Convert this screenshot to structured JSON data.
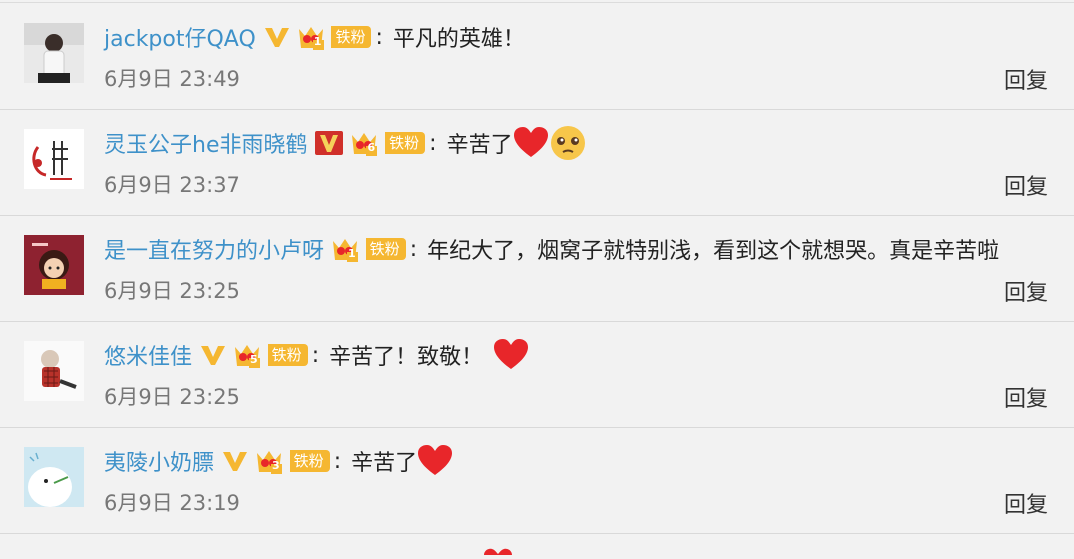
{
  "comments": [
    {
      "user": "jackpot仔QAQ",
      "verify": "gold",
      "fan_level": "1",
      "fan_label": "铁粉",
      "text": "平凡的英雄！",
      "hearts": 0,
      "teary": false,
      "time": "6月9日 23:49",
      "reply": "回复",
      "avatar": "person-avatar"
    },
    {
      "user": "灵玉公子he非雨晓鹤",
      "verify": "red",
      "fan_level": "6",
      "fan_label": "铁粉",
      "text": "辛苦了",
      "hearts": 1,
      "teary": true,
      "time": "6月9日 23:37",
      "reply": "回复",
      "avatar": "calligraphy-avatar"
    },
    {
      "user": "是一直在努力的小卢呀",
      "verify": "none",
      "fan_level": "1",
      "fan_label": "铁粉",
      "text": "年纪大了，烟窝子就特别浅，看到这个就想哭。真是辛苦啦",
      "hearts": 0,
      "teary": false,
      "time": "6月9日 23:25",
      "reply": "回复",
      "avatar": "cartoon-girl-avatar"
    },
    {
      "user": "悠米佳佳",
      "verify": "gold",
      "fan_level": "5",
      "fan_label": "铁粉",
      "text": "辛苦了！致敬！",
      "hearts": 1,
      "teary": false,
      "time": "6月9日 23:25",
      "reply": "回复",
      "avatar": "sketch-girl-avatar"
    },
    {
      "user": "夷陵小奶膘",
      "verify": "gold",
      "fan_level": "3",
      "fan_label": "铁粉",
      "text": "辛苦了",
      "hearts": 1,
      "teary": false,
      "time": "6月9日 23:19",
      "reply": "回复",
      "avatar": "bird-avatar"
    }
  ],
  "colors": {
    "username": "#3e91c9",
    "badge_gold": "#f5b731",
    "badge_red": "#d0302a",
    "heart": "#e8262a",
    "background": "#f2f2f2"
  }
}
